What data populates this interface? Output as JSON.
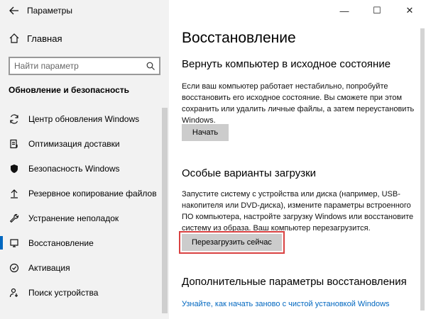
{
  "window": {
    "title": "Параметры",
    "back_icon": "arrow-left-icon",
    "controls": {
      "minimize": "—",
      "maximize": "☐",
      "close": "✕"
    }
  },
  "sidebar": {
    "home_label": "Главная",
    "search_placeholder": "Найти параметр",
    "section_heading": "Обновление и безопасность",
    "items": [
      {
        "label": "Центр обновления Windows",
        "icon": "sync-icon"
      },
      {
        "label": "Оптимизация доставки",
        "icon": "delivery-optimization-icon"
      },
      {
        "label": "Безопасность Windows",
        "icon": "shield-icon"
      },
      {
        "label": "Резервное копирование файлов",
        "icon": "backup-arrow-icon"
      },
      {
        "label": "Устранение неполадок",
        "icon": "wrench-icon"
      },
      {
        "label": "Восстановление",
        "icon": "recovery-icon",
        "active": true
      },
      {
        "label": "Активация",
        "icon": "activation-check-icon"
      },
      {
        "label": "Поиск устройства",
        "icon": "person-locate-icon"
      }
    ]
  },
  "main": {
    "title": "Восстановление",
    "reset": {
      "heading": "Вернуть компьютер в исходное состояние",
      "description": "Если ваш компьютер работает нестабильно, попробуйте восстановить его исходное состояние. Вы сможете при этом сохранить или удалить личные файлы, а затем переустановить Windows.",
      "button_label": "Начать"
    },
    "advanced_startup": {
      "heading": "Особые варианты загрузки",
      "description": "Запустите систему с устройства или диска (например, USB-накопителя или DVD-диска), измените параметры встроенного ПО компьютера, настройте загрузку Windows или восстановите систему из образа. Ваш компьютер перезагрузится.",
      "button_label": "Перезагрузить сейчас"
    },
    "more_options": {
      "heading": "Дополнительные параметры восстановления",
      "link": "Узнайте, как начать заново с чистой установкой Windows"
    }
  },
  "colors": {
    "accent": "#0067c0",
    "highlight": "#d94141",
    "sidebar_bg": "#f2f2f2",
    "button_bg": "#cccccc"
  }
}
